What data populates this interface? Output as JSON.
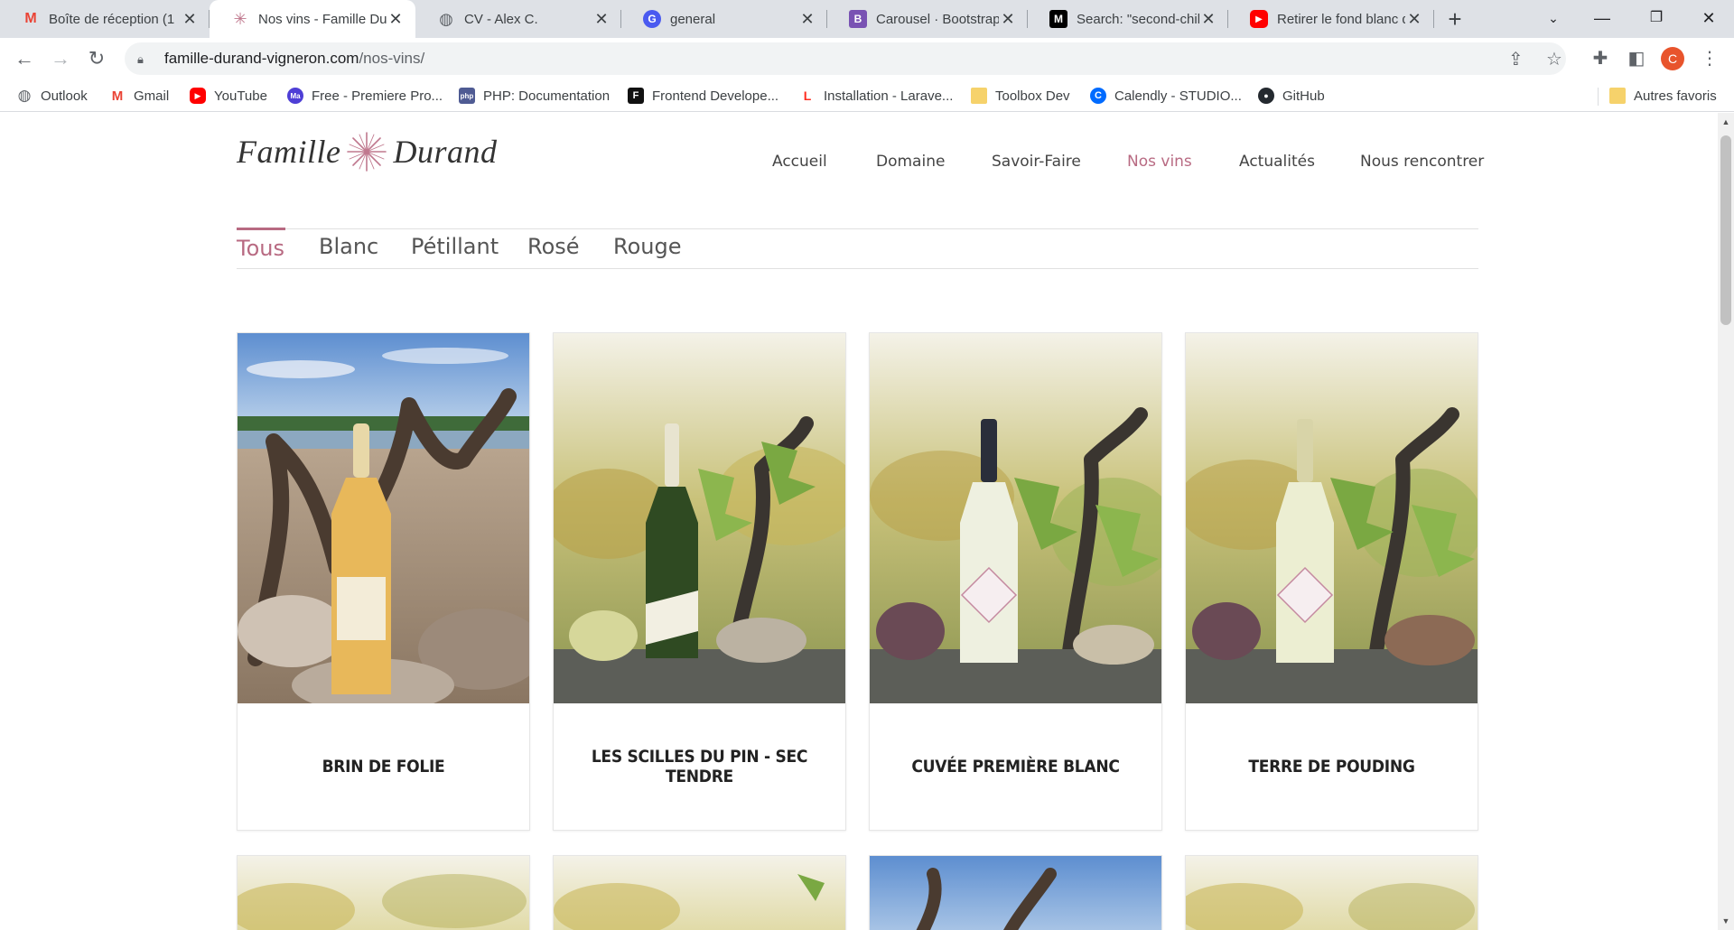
{
  "browser": {
    "tabs": [
      {
        "title": "Boîte de réception (1",
        "icon": "gmail-icon",
        "color": "#ea4335",
        "glyph": "M"
      },
      {
        "title": "Nos vins - Famille Dur",
        "icon": "famille-durand-icon",
        "color": "#c0788e",
        "glyph": "✳"
      },
      {
        "title": "CV - Alex C.",
        "icon": "globe-icon",
        "color": "#5f6368",
        "glyph": "◍"
      },
      {
        "title": "general",
        "icon": "chat-icon",
        "color": "#4a5af0",
        "glyph": "G"
      },
      {
        "title": "Carousel · Bootstrap",
        "icon": "bootstrap-icon",
        "color": "#7952b3",
        "glyph": "B"
      },
      {
        "title": "Search: \"second-child",
        "icon": "mdn-icon",
        "color": "#000000",
        "glyph": "M"
      },
      {
        "title": "Retirer le fond blanc d",
        "icon": "youtube-icon",
        "color": "#ff0000",
        "glyph": "▶"
      }
    ],
    "url_domain": "famille-durand-vigneron.com",
    "url_path": "/nos-vins/",
    "profile_initial": "C",
    "bookmarks": [
      {
        "label": "Outlook",
        "icon": "globe-icon",
        "color": "#5f6368",
        "glyph": "◍"
      },
      {
        "label": "Gmail",
        "icon": "gmail-icon",
        "color": "#ea4335",
        "glyph": "M"
      },
      {
        "label": "YouTube",
        "icon": "youtube-icon",
        "color": "#ff0000",
        "glyph": "▶"
      },
      {
        "label": "Free - Premiere Pro...",
        "icon": "motion-array-icon",
        "color": "#4e3fd6",
        "glyph": "Ma"
      },
      {
        "label": "PHP: Documentation",
        "icon": "php-icon",
        "color": "#4f5b93",
        "glyph": "php"
      },
      {
        "label": "Frontend Develope...",
        "icon": "frontend-mentor-icon",
        "color": "#111111",
        "glyph": "F"
      },
      {
        "label": "Installation - Larave...",
        "icon": "laravel-icon",
        "color": "#ff2d20",
        "glyph": "L"
      },
      {
        "label": "Toolbox Dev",
        "icon": "folder-icon",
        "color": "#f6d26b",
        "glyph": ""
      },
      {
        "label": "Calendly - STUDIO...",
        "icon": "calendly-icon",
        "color": "#006bff",
        "glyph": "C"
      },
      {
        "label": "GitHub",
        "icon": "github-icon",
        "color": "#24292f",
        "glyph": "●"
      }
    ],
    "other_bookmarks": "Autres favoris"
  },
  "site": {
    "logo_left": "Famille",
    "logo_right": "Durand",
    "nav": [
      "Accueil",
      "Domaine",
      "Savoir-Faire",
      "Nos vins",
      "Actualités",
      "Nous rencontrer"
    ],
    "active_nav": "Nos vins",
    "filters": [
      "Tous",
      "Blanc",
      "Pétillant",
      "Rosé",
      "Rouge"
    ],
    "active_filter": "Tous",
    "accent_color": "#b86a82",
    "wines": [
      {
        "name": "Brin de Folie"
      },
      {
        "name": "Les Scilles du Pin - Sec Tendre"
      },
      {
        "name": "Cuvée Première Blanc"
      },
      {
        "name": "Terre de Pouding"
      }
    ]
  }
}
